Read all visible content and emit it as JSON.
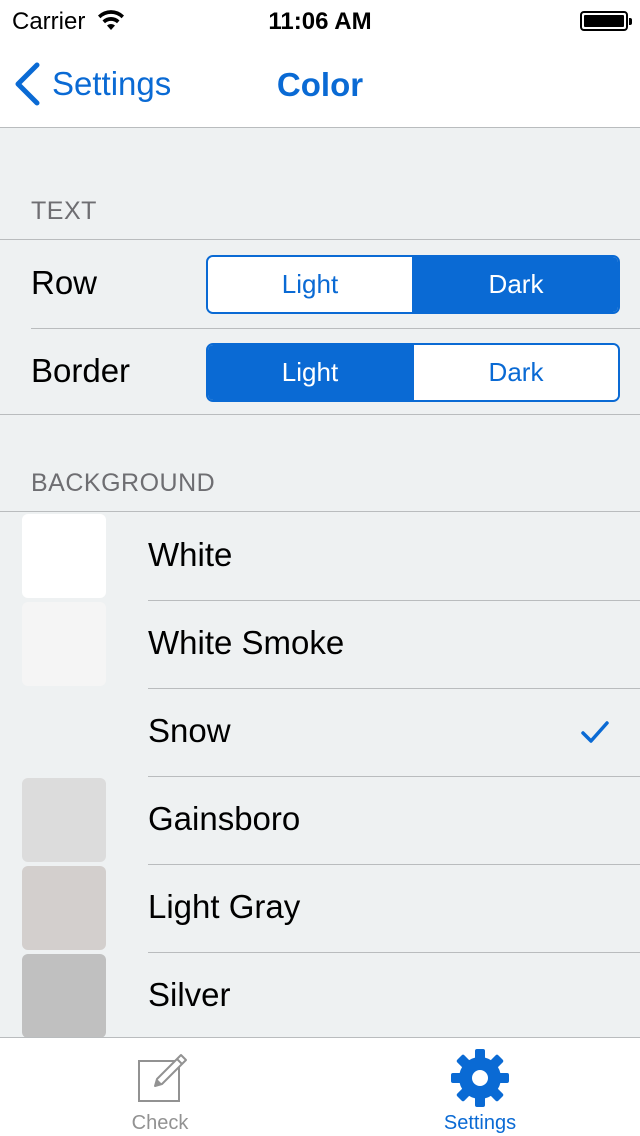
{
  "status_bar": {
    "carrier": "Carrier",
    "time": "11:06 AM"
  },
  "nav": {
    "back_label": "Settings",
    "title": "Color"
  },
  "text_section": {
    "header": "TEXT",
    "rows": [
      {
        "label": "Row",
        "options": [
          "Light",
          "Dark"
        ],
        "selected": "Dark"
      },
      {
        "label": "Border",
        "options": [
          "Light",
          "Dark"
        ],
        "selected": "Light"
      }
    ]
  },
  "background_section": {
    "header": "BACKGROUND",
    "items": [
      {
        "label": "White",
        "color": "#ffffff",
        "checked": false
      },
      {
        "label": "White Smoke",
        "color": "#f5f5f5",
        "checked": false
      },
      {
        "label": "Snow",
        "color": "#fffafa",
        "checked": true
      },
      {
        "label": "Gainsboro",
        "color": "#dcdcdc",
        "checked": false
      },
      {
        "label": "Light Gray",
        "color": "#d3cfcd",
        "checked": false
      },
      {
        "label": "Silver",
        "color": "#c0c0c0",
        "checked": false
      }
    ]
  },
  "tab_bar": {
    "tabs": [
      {
        "label": "Check",
        "icon": "edit-icon",
        "active": false
      },
      {
        "label": "Settings",
        "icon": "gear-icon",
        "active": true
      }
    ]
  },
  "colors": {
    "accent": "#0a6ad4",
    "background": "#eef1f2",
    "separator": "#b9bcbe"
  }
}
